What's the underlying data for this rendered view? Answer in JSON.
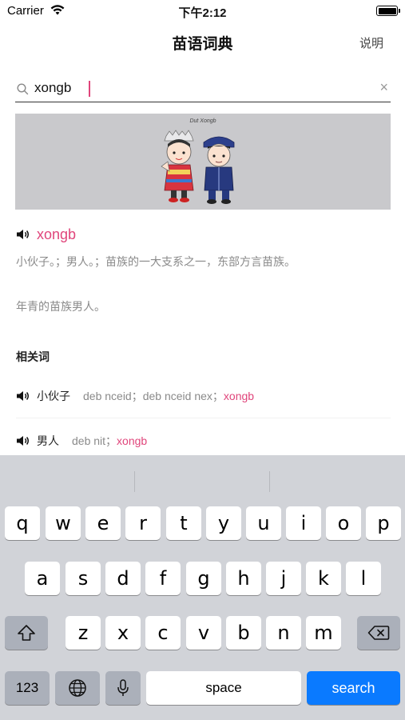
{
  "status_bar": {
    "carrier": "Carrier",
    "time": "下午2:12"
  },
  "nav": {
    "title": "苗语词典",
    "help_label": "说明"
  },
  "search": {
    "value": "xongb",
    "placeholder": ""
  },
  "banner": {
    "caption": "Dut Xongb"
  },
  "entry": {
    "word": "xongb",
    "definition": "小伙子。；男人。；苗族的一大支系之一，东部方言苗族。",
    "note": "年青的苗族男人。"
  },
  "related": {
    "title": "相关词",
    "items": [
      {
        "chinese": "小伙子",
        "meta": "deb nceid；deb nceid nex；",
        "highlight": "xongb"
      },
      {
        "chinese": "男人",
        "meta": "deb nit；",
        "highlight": "xongb"
      }
    ]
  },
  "keyboard": {
    "row1": [
      "q",
      "w",
      "e",
      "r",
      "t",
      "y",
      "u",
      "i",
      "o",
      "p"
    ],
    "row2": [
      "a",
      "s",
      "d",
      "f",
      "g",
      "h",
      "j",
      "k",
      "l"
    ],
    "row3": [
      "z",
      "x",
      "c",
      "v",
      "b",
      "n",
      "m"
    ],
    "numbers_label": "123",
    "space_label": "space",
    "search_label": "search"
  },
  "colors": {
    "accent": "#e0457b",
    "key_blue": "#0a7aff"
  }
}
